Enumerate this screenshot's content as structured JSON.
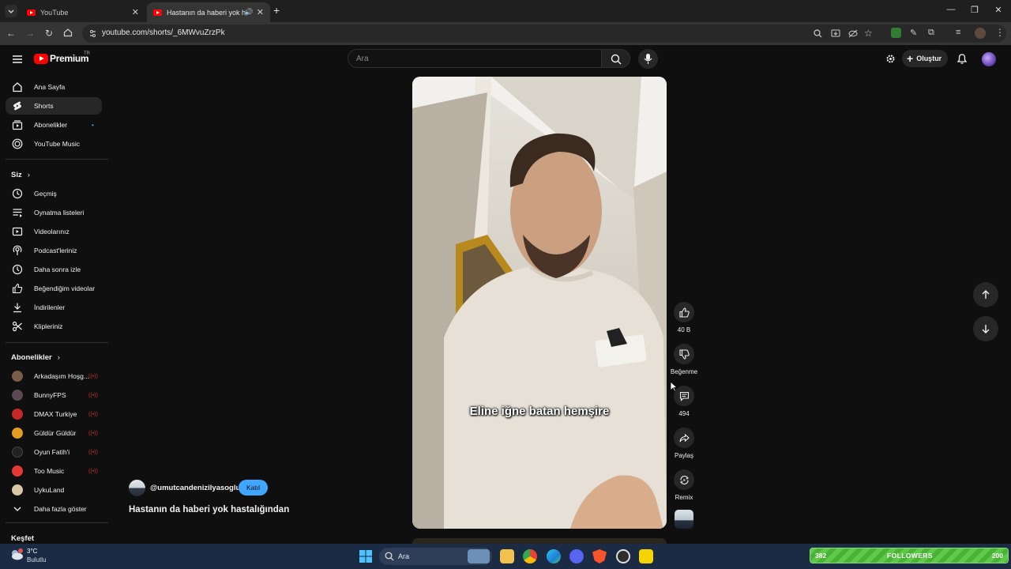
{
  "browser": {
    "tabs": [
      {
        "label": "YouTube",
        "active": false
      },
      {
        "label": "Hastanın da haberi yok has",
        "active": true
      }
    ],
    "url": "youtube.com/shorts/_6MWvuZrzPk"
  },
  "masthead": {
    "logo_text": "Premium",
    "logo_region": "TR",
    "search_placeholder": "Ara",
    "create_label": "Oluştur"
  },
  "sidebar": {
    "main": [
      {
        "label": "Ana Sayfa",
        "icon": "home-icon"
      },
      {
        "label": "Shorts",
        "icon": "shorts-icon",
        "active": true
      },
      {
        "label": "Abonelikler",
        "icon": "subscriptions-icon"
      },
      {
        "label": "YouTube Music",
        "icon": "youtube-music-icon"
      }
    ],
    "you_heading": "Siz",
    "you": [
      {
        "label": "Geçmiş",
        "icon": "history-icon"
      },
      {
        "label": "Oynatma listeleri",
        "icon": "playlists-icon"
      },
      {
        "label": "Videolarınız",
        "icon": "your-videos-icon"
      },
      {
        "label": "Podcast'leriniz",
        "icon": "podcasts-icon"
      },
      {
        "label": "Daha sonra izle",
        "icon": "watch-later-icon"
      },
      {
        "label": "Beğendiğim videolar",
        "icon": "liked-videos-icon"
      },
      {
        "label": "İndirilenler",
        "icon": "downloads-icon"
      },
      {
        "label": "Klipleriniz",
        "icon": "clips-icon"
      }
    ],
    "subs_heading": "Abonelikler",
    "subscriptions": [
      {
        "label": "Arkadaşım Hoşg...",
        "color": "#7a5c49"
      },
      {
        "label": "BunnyFPS",
        "color": "#5b4a55"
      },
      {
        "label": "DMAX Turkiye",
        "color": "#c62828"
      },
      {
        "label": "Güldür Güldür",
        "color": "#e59b1f"
      },
      {
        "label": "Oyun Fatih'i",
        "color": "#222222"
      },
      {
        "label": "Too Music",
        "color": "#e53935"
      },
      {
        "label": "UykuLand",
        "color": "#d9c7a8"
      }
    ],
    "show_more": "Daha fazla göster",
    "explore_heading": "Keşfet"
  },
  "short": {
    "caption": "Eline iğne batan hemşire",
    "channel": "@umutcandenizilyasoglu",
    "join_label": "Katıl",
    "title": "Hastanın da haberi yok hastalığından",
    "actions": {
      "like_count": "40 B",
      "dislike_label": "Beğenme",
      "comment_count": "494",
      "share_label": "Paylaş",
      "remix_label": "Remix"
    }
  },
  "taskbar": {
    "weather_temp": "3°C",
    "weather_desc": "Bulutlu",
    "search_placeholder": "Ara",
    "followers": {
      "current": "382",
      "label": "FOLLOWERS",
      "goal": "200"
    }
  }
}
